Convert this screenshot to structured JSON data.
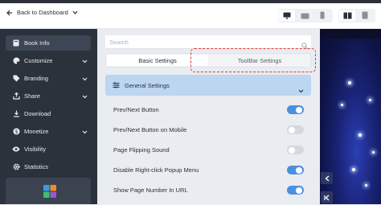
{
  "topbar": {
    "back_label": "Back to Dashboard",
    "device_icons": [
      "desktop-icon",
      "tablet-landscape-icon",
      "mobile-icon"
    ],
    "view_icons": [
      "two-page-spread-icon",
      "single-page-icon"
    ]
  },
  "sidebar": {
    "items": [
      {
        "label": "Book Info",
        "icon": "book-icon",
        "active": true,
        "has_chevron": false
      },
      {
        "label": "Customize",
        "icon": "palette-icon",
        "active": false,
        "has_chevron": true
      },
      {
        "label": "Branding",
        "icon": "tag-icon",
        "active": false,
        "has_chevron": true
      },
      {
        "label": "Share",
        "icon": "share-icon",
        "active": false,
        "has_chevron": true
      },
      {
        "label": "Download",
        "icon": "download-icon",
        "active": false,
        "has_chevron": false
      },
      {
        "label": "Monetize",
        "icon": "dollar-icon",
        "active": false,
        "has_chevron": true
      },
      {
        "label": "Visibility",
        "icon": "eye-icon",
        "active": false,
        "has_chevron": false
      },
      {
        "label": "Statistics",
        "icon": "gear-icon",
        "active": false,
        "has_chevron": false
      }
    ]
  },
  "search": {
    "placeholder": "Search"
  },
  "tabs": [
    {
      "label": "Basic Settings",
      "active": true
    },
    {
      "label": "ToolBar Settings",
      "active": false
    }
  ],
  "section": {
    "title": "General Settings",
    "expanded": true
  },
  "settings": [
    {
      "label": "Prev/Next Button",
      "on": true
    },
    {
      "label": "Prev/Next Button on Mobile",
      "on": false
    },
    {
      "label": "Page Flipping Sound",
      "on": false
    },
    {
      "label": "Disable Right-click Popup Menu",
      "on": true
    },
    {
      "label": "Show Page Number In URL",
      "on": true
    }
  ],
  "colors": {
    "sidebar_bg": "#2b323c",
    "accent": "#4a8fe0",
    "section_bg": "#bcd5f0",
    "highlight": "#dd3b3b"
  }
}
